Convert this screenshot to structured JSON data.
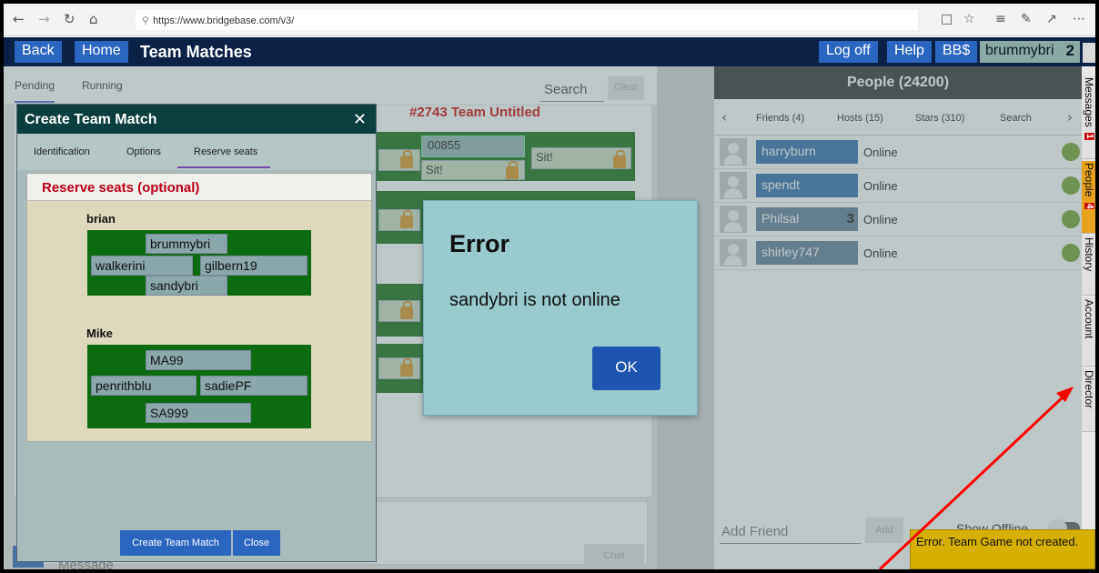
{
  "browser": {
    "url": "https://www.bridgebase.com/v3/"
  },
  "appbar": {
    "back": "Back",
    "home": "Home",
    "title": "Team Matches",
    "logoff": "Log off",
    "help": "Help",
    "bbdollars": "BB$",
    "username": "brummybri",
    "badge": "2"
  },
  "left": {
    "tabs": [
      "Pending",
      "Running"
    ],
    "search_label": "Search",
    "clear": "Clear",
    "match_title_fragment": "#2743 Team Untitled",
    "seats": {
      "top_right_name": "00855",
      "sit_a": "Sit!",
      "sit_b": "Sit!"
    },
    "message_placeholder": "Message",
    "chat": "Chat"
  },
  "create_dialog": {
    "title": "Create Team Match",
    "close_icon": "close-icon",
    "tabs": [
      "Identification",
      "Options",
      "Reserve seats"
    ],
    "active_tab": "Reserve seats",
    "panel_title": "Reserve seats (optional)",
    "teams": [
      {
        "name": "brian",
        "north": "brummybri",
        "west": "walkerini",
        "east": "gilbern19",
        "south": "sandybri"
      },
      {
        "name": "Mike",
        "north": "MA99",
        "west": "penrithblu",
        "east": "sadiePF",
        "south": "SA999"
      }
    ],
    "create_button": "Create Team Match",
    "close_button": "Close"
  },
  "error_dialog": {
    "title": "Error",
    "message": "sandybri is not online",
    "ok": "OK"
  },
  "people": {
    "header": "People (24200)",
    "tabs": [
      "Friends (4)",
      "Hosts (15)",
      "Stars (310)",
      "Search"
    ],
    "rows": [
      {
        "name": "harryburn",
        "status": "Online",
        "badge": ""
      },
      {
        "name": "spendt",
        "status": "Online",
        "badge": ""
      },
      {
        "name": "Philsal",
        "status": "Online",
        "badge": "3"
      },
      {
        "name": "shirley747",
        "status": "Online",
        "badge": ""
      }
    ],
    "add_friend_placeholder": "Add Friend",
    "add": "Add",
    "show_offline": "Show Offline"
  },
  "side_tabs": [
    {
      "label": "Messages",
      "count": "1"
    },
    {
      "label": "People",
      "count": "4"
    },
    {
      "label": "History",
      "count": ""
    },
    {
      "label": "Account",
      "count": ""
    },
    {
      "label": "Director",
      "count": ""
    }
  ],
  "toast": {
    "message": "Error. Team Game not created."
  },
  "colors": {
    "appbar": "#0b2246",
    "button_blue": "#2a65c0",
    "table_green": "#0c6b10",
    "error_bg": "#98cace",
    "alert_red": "#ff0000",
    "toast": "#d6b000"
  }
}
